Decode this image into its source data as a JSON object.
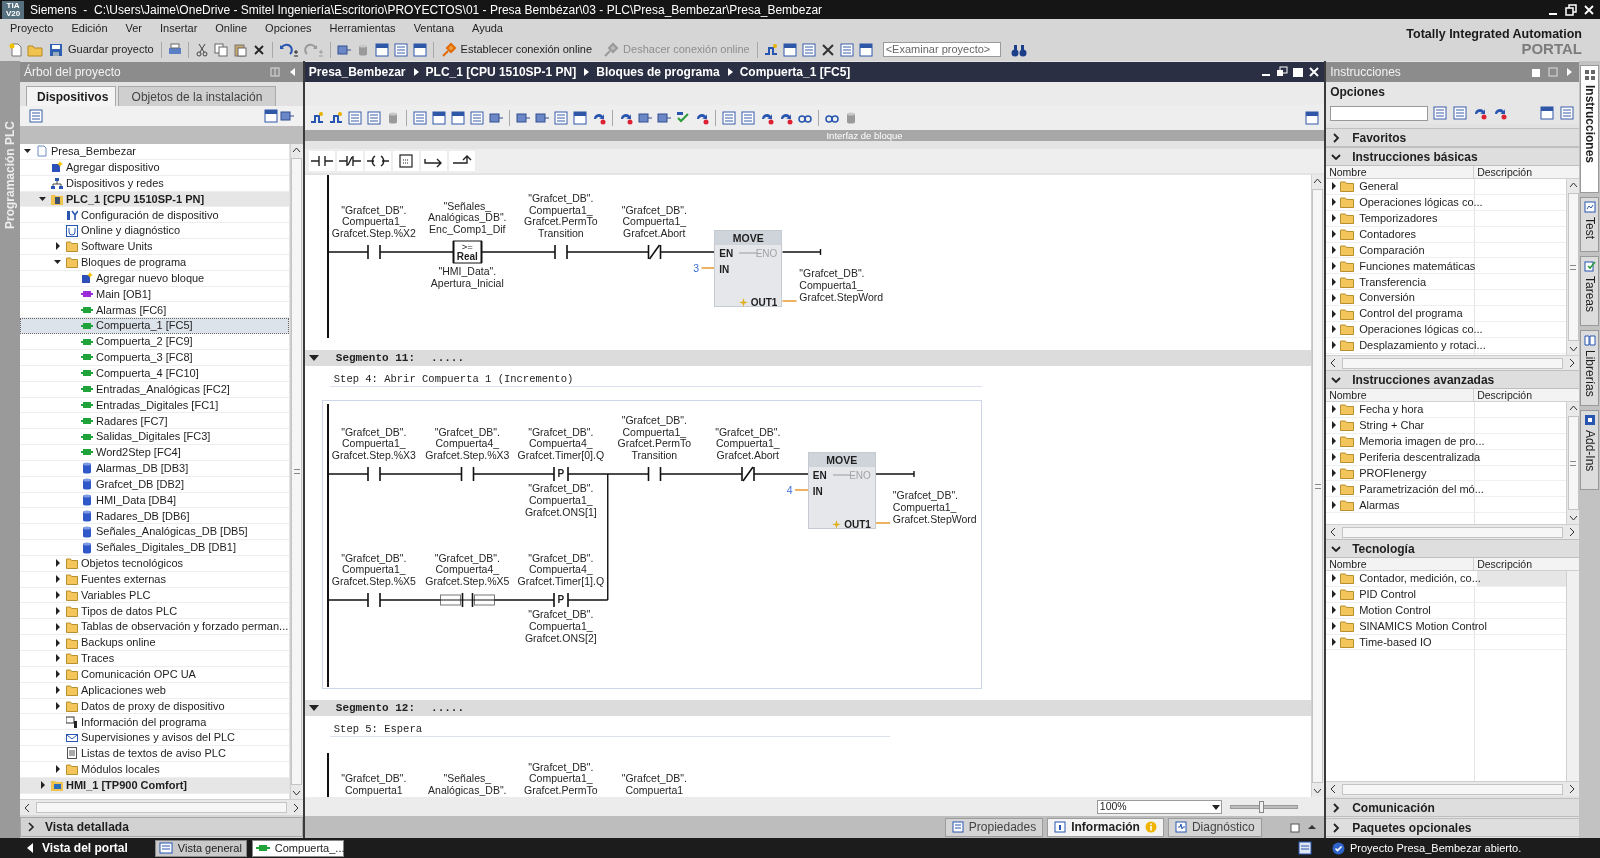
{
  "window": {
    "logo_lines": [
      "TIA",
      "V20"
    ],
    "title": "Siemens  -  C:\\Users\\Jaime\\OneDrive - Smitel Ingeniería\\Escritorio\\PROYECTOS\\01 - Presa Bembézar\\03 - PLC\\Presa_Bembezar\\Presa_Bembezar"
  },
  "menu": [
    "Proyecto",
    "Edición",
    "Ver",
    "Insertar",
    "Online",
    "Opciones",
    "Herramientas",
    "Ventana",
    "Ayuda"
  ],
  "toolbar": {
    "save_label": "Guardar proyecto",
    "connect_label": "Establecer conexión online",
    "disconnect": {
      "label": "Deshacer conexión online",
      "disabled": true
    },
    "search_placeholder": "<Examinar proyecto>"
  },
  "branding": {
    "line1": "Totally Integrated Automation",
    "line2": "PORTAL"
  },
  "side_tab": "Programación PLC",
  "project_tree": {
    "title": "Árbol del proyecto",
    "tabs": [
      {
        "label": "Dispositivos",
        "selected": true
      },
      {
        "label": "Objetos de la instalación",
        "selected": false
      }
    ],
    "items": [
      {
        "label": "Presa_Bembezar",
        "kind": "project",
        "expanded": true,
        "selected": false,
        "children": [
          {
            "label": "Agregar dispositivo",
            "kind": "add",
            "selected": false
          },
          {
            "label": "Dispositivos y redes",
            "kind": "network",
            "selected": false
          },
          {
            "label": "PLC_1 [CPU 1510SP-1 PN]",
            "kind": "plc",
            "expanded": true,
            "selected": false,
            "children": [
              {
                "label": "Configuración de dispositivo",
                "kind": "config",
                "selected": false
              },
              {
                "label": "Online y diagnóstico",
                "kind": "diag",
                "selected": false
              },
              {
                "label": "Software Units",
                "kind": "folder",
                "expanded": false,
                "selected": false
              },
              {
                "label": "Bloques de programa",
                "kind": "folder",
                "expanded": true,
                "selected": false,
                "children": [
                  {
                    "label": "Agregar nuevo bloque",
                    "kind": "add",
                    "selected": false
                  },
                  {
                    "label": "Main [OB1]",
                    "kind": "ob",
                    "selected": false
                  },
                  {
                    "label": "Alarmas [FC6]",
                    "kind": "fc",
                    "selected": false
                  },
                  {
                    "label": "Compuerta_1 [FC5]",
                    "kind": "fc",
                    "selected": true
                  },
                  {
                    "label": "Compuerta_2 [FC9]",
                    "kind": "fc",
                    "selected": false
                  },
                  {
                    "label": "Compuerta_3 [FC8]",
                    "kind": "fc",
                    "selected": false
                  },
                  {
                    "label": "Compuerta_4 [FC10]",
                    "kind": "fc",
                    "selected": false
                  },
                  {
                    "label": "Entradas_Analógicas [FC2]",
                    "kind": "fc",
                    "selected": false
                  },
                  {
                    "label": "Entradas_Digitales [FC1]",
                    "kind": "fc",
                    "selected": false
                  },
                  {
                    "label": "Radares [FC7]",
                    "kind": "fc",
                    "selected": false
                  },
                  {
                    "label": "Salidas_Digitales [FC3]",
                    "kind": "fc",
                    "selected": false
                  },
                  {
                    "label": "Word2Step [FC4]",
                    "kind": "fc",
                    "selected": false
                  },
                  {
                    "label": "Alarmas_DB [DB3]",
                    "kind": "db",
                    "selected": false
                  },
                  {
                    "label": "Grafcet_DB [DB2]",
                    "kind": "db",
                    "selected": false
                  },
                  {
                    "label": "HMI_Data [DB4]",
                    "kind": "db",
                    "selected": false
                  },
                  {
                    "label": "Radares_DB [DB6]",
                    "kind": "db",
                    "selected": false
                  },
                  {
                    "label": "Señales_Analógicas_DB [DB5]",
                    "kind": "db",
                    "selected": false
                  },
                  {
                    "label": "Señales_Digitales_DB [DB1]",
                    "kind": "db",
                    "selected": false
                  }
                ]
              },
              {
                "label": "Objetos tecnológicos",
                "kind": "folder",
                "expanded": false,
                "selected": false
              },
              {
                "label": "Fuentes externas",
                "kind": "folder",
                "expanded": false,
                "selected": false
              },
              {
                "label": "Variables PLC",
                "kind": "folder",
                "expanded": false,
                "selected": false
              },
              {
                "label": "Tipos de datos PLC",
                "kind": "folder",
                "expanded": false,
                "selected": false
              },
              {
                "label": "Tablas de observación y forzado perman...",
                "kind": "folder",
                "expanded": false,
                "selected": false
              },
              {
                "label": "Backups online",
                "kind": "folder",
                "expanded": false,
                "selected": false
              },
              {
                "label": "Traces",
                "kind": "folder",
                "expanded": false,
                "selected": false
              },
              {
                "label": "Comunicación OPC UA",
                "kind": "folder",
                "expanded": false,
                "selected": false
              },
              {
                "label": "Aplicaciones web",
                "kind": "folder",
                "expanded": false,
                "selected": false
              },
              {
                "label": "Datos de proxy de dispositivo",
                "kind": "folder",
                "expanded": false,
                "selected": false
              },
              {
                "label": "Información del programa",
                "kind": "info",
                "selected": false
              },
              {
                "label": "Supervisiones y avisos del PLC",
                "kind": "mail",
                "selected": false
              },
              {
                "label": "Listas de textos de aviso PLC",
                "kind": "list",
                "selected": false
              },
              {
                "label": "Módulos locales",
                "kind": "folder",
                "expanded": false,
                "selected": false
              }
            ]
          },
          {
            "label": "HMI_1 [TP900 Comfort]",
            "kind": "hmi",
            "expanded": false,
            "selected": false
          }
        ]
      }
    ]
  },
  "detail_view": "Vista detallada",
  "editor": {
    "breadcrumb": [
      "Presa_Bembezar",
      "PLC_1 [CPU 1510SP-1 PN]",
      "Bloques de programa",
      "Compuerta_1 [FC5]"
    ],
    "interface_bar": "Interfaz de bloque",
    "networks": [
      {
        "rows": [
          [
            {
              "kind": "contact",
              "operand": "\"Grafcet_DB\".\nCompuerta1_\nGrafcet.Step.%X2"
            },
            {
              "kind": "compare",
              "operand": "\"Señales_\nAnalógicas_DB\".\nEnc_Comp1_Dif",
              "operator": ">=",
              "type": "Real",
              "operand2": "\"HMI_Data\".\nApertura_Inicial"
            },
            {
              "kind": "contact",
              "operand": "\"Grafcet_DB\".\nCompuerta1_\nGrafcet.PermTo\nTransition"
            },
            {
              "kind": "nc_contact",
              "operand": "\"Grafcet_DB\".\nCompuerta1_\nGrafcet.Abort"
            }
          ]
        ],
        "box": {
          "name": "MOVE",
          "en": "EN",
          "eno": "ENO",
          "in": "IN",
          "in_value": "3",
          "out": "OUT1",
          "out_operand": "\"Grafcet_DB\".\nCompuerta1_\nGrafcet.StepWord"
        }
      },
      {
        "title": "Segmento 11:",
        "dots": ".....",
        "comment": "Step 4: Abrir Compuerta 1 (Incremento)",
        "rows": [
          [
            {
              "kind": "contact",
              "operand": "\"Grafcet_DB\".\nCompuerta1_\nGrafcet.Step.%X3"
            },
            {
              "kind": "contact",
              "operand": "\"Grafcet_DB\".\nCompuerta4_\nGrafcet.Step.%X3"
            },
            {
              "kind": "p_contact",
              "operand": "\"Grafcet_DB\".\nCompuerta4_\nGrafcet.Timer[0].Q",
              "symbol": "P",
              "operand2": "\"Grafcet_DB\".\nCompuerta1_\nGrafcet.ONS[1]"
            }
          ],
          [
            {
              "kind": "contact",
              "operand": "\"Grafcet_DB\".\nCompuerta1_\nGrafcet.Step.%X5"
            },
            {
              "kind": "marked_contact",
              "operand": "\"Grafcet_DB\".\nCompuerta4_\nGrafcet.Step.%X5"
            },
            {
              "kind": "p_contact",
              "operand": "\"Grafcet_DB\".\nCompuerta4_\nGrafcet.Timer[1].Q",
              "symbol": "P",
              "operand2": "\"Grafcet_DB\".\nCompuerta1_\nGrafcet.ONS[2]"
            }
          ]
        ],
        "series": [
          {
            "kind": "contact",
            "operand": "\"Grafcet_DB\".\nCompuerta1_\nGrafcet.PermTo\nTransition"
          },
          {
            "kind": "nc_contact",
            "operand": "\"Grafcet_DB\".\nCompuerta1_\nGrafcet.Abort"
          }
        ],
        "box": {
          "name": "MOVE",
          "en": "EN",
          "eno": "ENO",
          "in": "IN",
          "in_value": "4",
          "out": "OUT1",
          "out_operand": "\"Grafcet_DB\".\nCompuerta1_\nGrafcet.StepWord"
        }
      },
      {
        "title": "Segmento 12:",
        "dots": ".....",
        "comment": "Step 5: Espera",
        "rows": [
          [
            {
              "kind": "label_only",
              "operand": "\"Grafcet_DB\".\nCompuerta1"
            },
            {
              "kind": "label_only",
              "operand": "\"Señales_\nAnalógicas_DB\"."
            },
            {
              "kind": "label_only",
              "operand": "\"Grafcet_DB\".\nCompuerta1_\nGrafcet.PermTo"
            },
            {
              "kind": "label_only",
              "operand": "\"Grafcet_DB\".\nCompuerta1"
            }
          ]
        ]
      }
    ],
    "zoom": "100%",
    "zoom_slider": {
      "level": 0.45
    },
    "inspector_tabs": [
      {
        "label": "Propiedades",
        "selected": false
      },
      {
        "label": "Información",
        "selected": true
      },
      {
        "label": "Diagnóstico",
        "selected": false
      }
    ]
  },
  "instructions": {
    "title": "Instrucciones",
    "options": "Opciones",
    "sections": [
      {
        "title": "Favoritos",
        "expanded": false
      },
      {
        "title": "Instrucciones básicas",
        "expanded": true,
        "columns": [
          "Nombre",
          "Descripción"
        ],
        "items": [
          "General",
          "Operaciones lógicas co...",
          "Temporizadores",
          "Contadores",
          "Comparación",
          "Funciones matemáticas",
          "Transferencia",
          "Conversión",
          "Control del programa",
          "Operaciones lógicas co...",
          "Desplazamiento y rotaci..."
        ]
      },
      {
        "title": "Instrucciones avanzadas",
        "expanded": true,
        "columns": [
          "Nombre",
          "Descripción"
        ],
        "items": [
          "Fecha y hora",
          "String + Char",
          "Memoria imagen de pro...",
          "Periferia descentralizada",
          "PROFIenergy",
          "Parametrización del mó...",
          "Alarmas"
        ]
      },
      {
        "title": "Tecnología",
        "expanded": true,
        "columns": [
          "Nombre",
          "Descripción"
        ],
        "items": [
          "Contador, medición, co...",
          "PID Control",
          "Motion Control",
          "SINAMICS Motion Control",
          "Time-based IO"
        ]
      },
      {
        "title": "Comunicación",
        "expanded": false
      },
      {
        "title": "Paquetes opcionales",
        "expanded": false
      }
    ],
    "side_tabs": [
      {
        "label": "Instrucciones",
        "selected": true
      },
      {
        "label": "Test",
        "selected": false
      },
      {
        "label": "Tareas",
        "selected": false
      },
      {
        "label": "Librerías",
        "selected": false
      },
      {
        "label": "Add-Ins",
        "selected": false
      }
    ]
  },
  "status_bar": {
    "portal_view": "Vista del portal",
    "tabs": [
      {
        "label": "Vista general",
        "selected": false
      },
      {
        "label": "Compuerta_...",
        "selected": true
      }
    ],
    "message": "Proyecto Presa_Bembezar abierto."
  }
}
